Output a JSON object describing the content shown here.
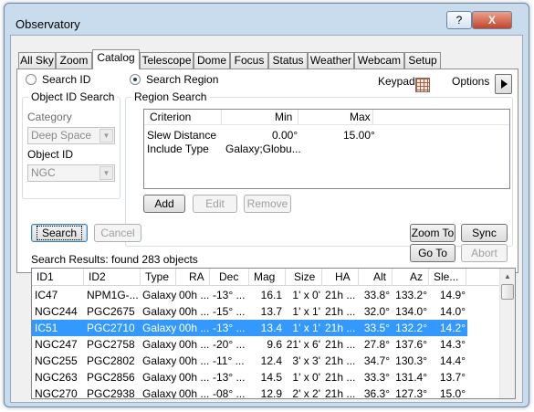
{
  "window": {
    "title": "Observatory",
    "help_label": "?",
    "close_label": "X"
  },
  "tabs": [
    "All Sky",
    "Zoom",
    "Catalog",
    "Telescope",
    "Dome",
    "Focus",
    "Status",
    "Weather",
    "Webcam",
    "Setup"
  ],
  "active_tab": "Catalog",
  "search_mode": {
    "search_id_label": "Search ID",
    "search_region_label": "Search Region",
    "selected": "Search Region"
  },
  "keypad_label": "Keypad",
  "options_label": "Options",
  "object_id_search": {
    "title": "Object ID Search",
    "category_label": "Category",
    "category_value": "Deep Space",
    "object_id_label": "Object ID",
    "object_id_value": "NGC"
  },
  "region_search": {
    "title": "Region Search",
    "columns": [
      "Criterion",
      "Min",
      "Max"
    ],
    "rows": [
      {
        "criterion": "Slew Distance",
        "min": "0.00°",
        "max": "15.00°"
      },
      {
        "criterion": "Include Type",
        "min": "Galaxy;Globu...",
        "max": ""
      }
    ],
    "add_label": "Add",
    "edit_label": "Edit",
    "remove_label": "Remove"
  },
  "actions": {
    "search_label": "Search",
    "cancel_label": "Cancel",
    "zoom_to_label": "Zoom To",
    "sync_label": "Sync",
    "go_to_label": "Go To",
    "abort_label": "Abort"
  },
  "results": {
    "summary": "Search Results: found 283 objects",
    "columns": [
      "ID1",
      "ID2",
      "Type",
      "RA",
      "Dec",
      "Mag",
      "Size",
      "HA",
      "Alt",
      "Az",
      "Sle..."
    ],
    "selected_row": 2,
    "rows": [
      [
        "IC47",
        "NPM1G-...",
        "Galaxy",
        "00h ...",
        "-13° ...",
        "16.1",
        "1' x 0'",
        "21h ...",
        "33.8°",
        "133.2°",
        "14.9°"
      ],
      [
        "NGC244",
        "PGC2675",
        "Galaxy",
        "00h ...",
        "-15° ...",
        "13.7",
        "1' x 1'",
        "21h ...",
        "32.0°",
        "134.0°",
        "14.0°"
      ],
      [
        "IC51",
        "PGC2710",
        "Galaxy",
        "00h ...",
        "-13° ...",
        "13.4",
        "1' x 1'",
        "21h ...",
        "33.5°",
        "132.2°",
        "14.2°"
      ],
      [
        "NGC247",
        "PGC2758",
        "Galaxy",
        "00h ...",
        "-20° ...",
        "9.6",
        "21' x 6'",
        "21h ...",
        "27.8°",
        "137.6°",
        "14.3°"
      ],
      [
        "NGC255",
        "PGC2802",
        "Galaxy",
        "00h ...",
        "-11° ...",
        "12.4",
        "3' x 3'",
        "21h ...",
        "34.7°",
        "130.3°",
        "14.4°"
      ],
      [
        "NGC263",
        "PGC2856",
        "Galaxy",
        "00h ...",
        "-13° ...",
        "14.5",
        "1' x 0'",
        "21h ...",
        "33.3°",
        "131.4°",
        "13.7°"
      ],
      [
        "NGC270",
        "PGC2938",
        "Galaxy",
        "00h ...",
        "-08° ...",
        "12.9",
        "2' x 2'",
        "21h ...",
        "36.3°",
        "127.3°",
        "15.0°"
      ]
    ]
  },
  "colors": {
    "selection": "#3399ff",
    "window_frame": "#c9dcee"
  }
}
